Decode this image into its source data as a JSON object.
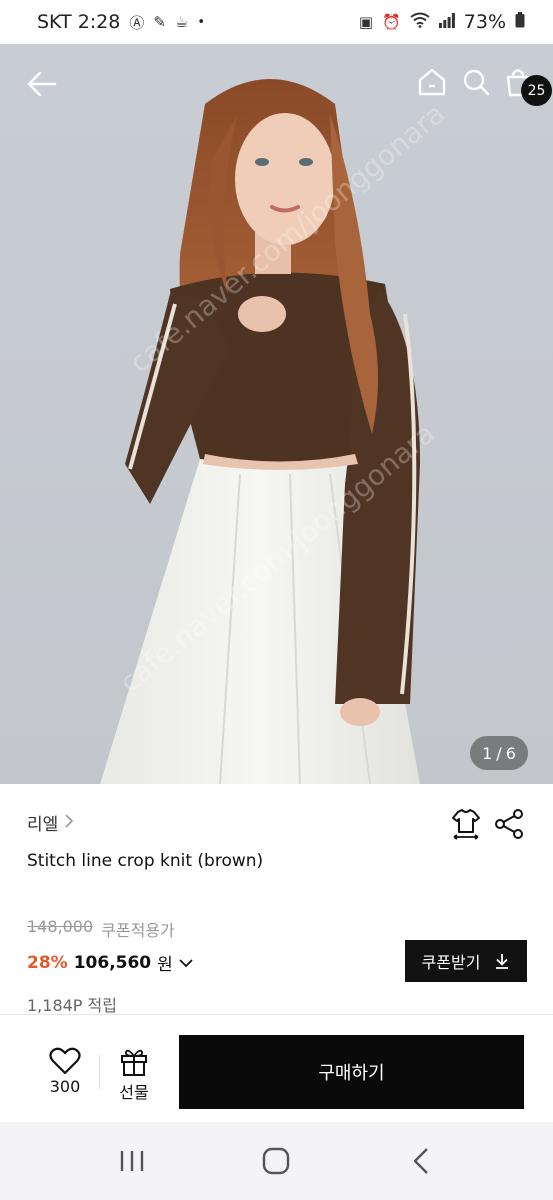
{
  "status_bar": {
    "carrier_time": "SKT 2:28",
    "battery": "73%",
    "left_icons": [
      "a-circle-icon",
      "leaf-icon",
      "cup-icon",
      "dot-icon"
    ],
    "right_icons": [
      "battery-saver-icon",
      "alarm-icon",
      "wifi-icon",
      "signal-icon",
      "battery-icon"
    ]
  },
  "hero": {
    "image_counter_current": "1",
    "image_counter_sep": "/",
    "image_counter_total": "6",
    "cart_count": "25"
  },
  "product": {
    "brand": "리엘",
    "brand_chevron": ">",
    "name": "Stitch line crop knit (brown)",
    "original_price": "148,000",
    "coupon_price_label": "쿠폰적용가",
    "discount": "28%",
    "price": "106,560",
    "currency": "원",
    "coupon_button_label": "쿠폰받기",
    "points": "1,184P 적립"
  },
  "action_bar": {
    "like_count": "300",
    "gift_label": "선물",
    "buy_label": "구매하기"
  },
  "colors": {
    "accent_discount": "#e05a2b",
    "button_dark": "#111111"
  }
}
